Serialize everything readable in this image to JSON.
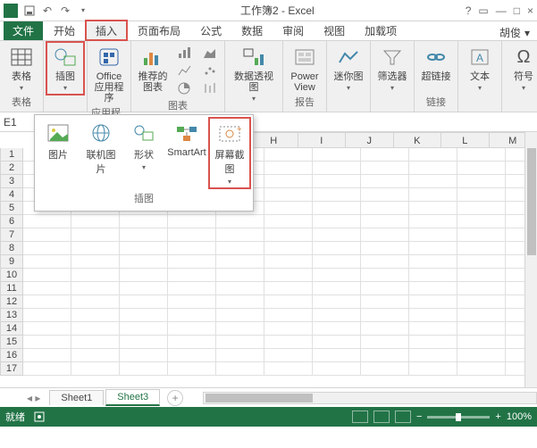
{
  "app": {
    "title": "工作簿2 - Excel",
    "user": "胡俊"
  },
  "tabs": {
    "file": "文件",
    "items": [
      "开始",
      "插入",
      "页面布局",
      "公式",
      "数据",
      "审阅",
      "视图",
      "加载项"
    ],
    "active": "插入"
  },
  "ribbon": {
    "groups": {
      "tables": {
        "label": "表格",
        "btn": "表格"
      },
      "illus": {
        "btn": "插图"
      },
      "apps": {
        "label": "应用程序",
        "btn": "Office\n应用程序"
      },
      "charts": {
        "label": "图表",
        "btn": "推荐的\n图表"
      },
      "pivot": {
        "btn": "数据透视图"
      },
      "reports": {
        "label": "报告",
        "btn": "Power\nView"
      },
      "spark": {
        "btn": "迷你图"
      },
      "filter": {
        "btn": "筛选器"
      },
      "links": {
        "label": "链接",
        "btn": "超链接"
      },
      "text": {
        "btn": "文本"
      },
      "symbols": {
        "btn": "符号"
      }
    }
  },
  "dropdown": {
    "items": [
      "图片",
      "联机图片",
      "形状",
      "SmartArt",
      "屏幕截图"
    ],
    "label": "插图"
  },
  "namebox": "E1",
  "columns": [
    "H",
    "I",
    "J",
    "K",
    "L",
    "M"
  ],
  "rows": [
    "1",
    "2",
    "3",
    "4",
    "5",
    "6",
    "7",
    "8",
    "9",
    "10",
    "11",
    "12",
    "13",
    "14",
    "15",
    "16",
    "17"
  ],
  "sheets": {
    "items": [
      "Sheet1",
      "Sheet3"
    ],
    "active": "Sheet3",
    "add": "+"
  },
  "status": {
    "ready": "就绪",
    "zoom": "100%"
  }
}
